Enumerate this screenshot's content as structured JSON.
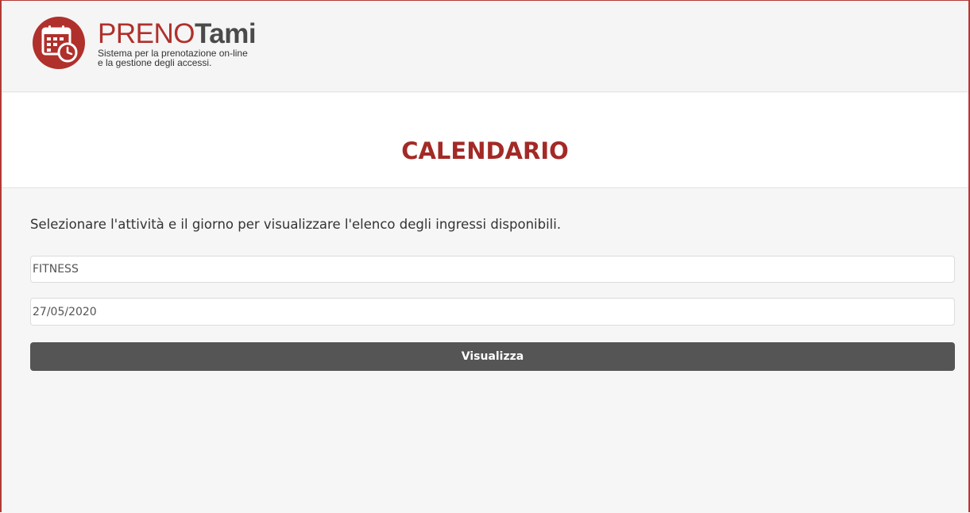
{
  "header": {
    "logo": {
      "icon": "calendar-clock-icon",
      "color": "#b0302c"
    },
    "brand_prefix": "PRENO",
    "brand_suffix": "Tami",
    "tagline_line1": "Sistema per la prenotazione on-line",
    "tagline_line2": "e la gestione degli accessi."
  },
  "page": {
    "title": "CALENDARIO",
    "instructions": "Selezionare l'attività e il giorno per visualizzare l'elenco degli ingressi disponibili."
  },
  "form": {
    "activity_value": "FITNESS",
    "date_value": "27/05/2020",
    "submit_label": "Visualizza"
  },
  "colors": {
    "brand_red": "#b0302c",
    "title_red": "#a32a26",
    "button_bg": "#555555"
  }
}
